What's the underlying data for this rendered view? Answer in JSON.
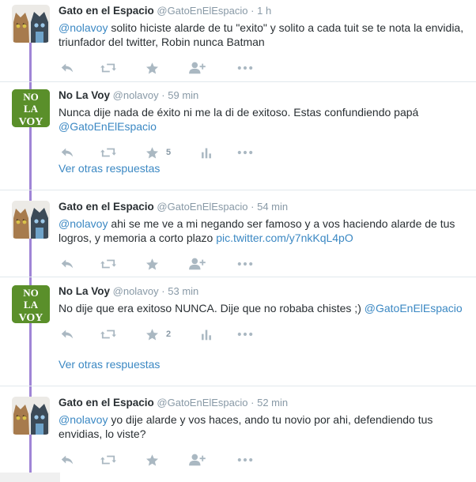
{
  "colors": {
    "thread_line": "#a085d6",
    "link": "#3b88c3",
    "meta": "#8899a6",
    "icon": "#aab8c2"
  },
  "tweets": [
    {
      "fullname": "Gato en el Espacio",
      "handle": "@GatoEnElEspacio",
      "sep": "·",
      "time": "1 h",
      "text": {
        "mention": "@nolavoy",
        "rest": " solito hiciste alarde de tu \"exito\" y solito a cada tuit se te nota la envidia, triunfador del twitter, Robin nunca Batman"
      },
      "stats": {
        "favorites": ""
      }
    },
    {
      "fullname": "No La Voy",
      "handle": "@nolavoy",
      "sep": "·",
      "time": "59 min",
      "text": {
        "before": "Nunca dije nada de éxito ni me la di de exitoso. Estas confundiendo papá ",
        "mention": "@GatoEnElEspacio"
      },
      "stats": {
        "favorites": "5"
      },
      "more_replies": "Ver otras respuestas"
    },
    {
      "fullname": "Gato en el Espacio",
      "handle": "@GatoEnElEspacio",
      "sep": "·",
      "time": "54 min",
      "text": {
        "mention": "@nolavoy",
        "rest": " ahi se me ve a mi negando ser famoso y a vos haciendo alarde de tus logros, y memoria a corto plazo ",
        "link": "pic.twitter.com/y7nkKqL4pO"
      },
      "stats": {
        "favorites": ""
      }
    },
    {
      "fullname": "No La Voy",
      "handle": "@nolavoy",
      "sep": "·",
      "time": "53 min",
      "text": {
        "before": "No dije que era exitoso NUNCA. Dije que no robaba chistes ;) ",
        "mention": "@GatoEnElEspacio"
      },
      "stats": {
        "favorites": "2"
      },
      "more_replies": "Ver otras respuestas"
    },
    {
      "fullname": "Gato en el Espacio",
      "handle": "@GatoEnElEspacio",
      "sep": "·",
      "time": "52 min",
      "text": {
        "mention": "@nolavoy",
        "rest": " yo dije alarde y vos haces, ando tu novio por ahi, defendiendo tus envidias, lo viste?"
      },
      "stats": {
        "favorites": ""
      }
    }
  ],
  "avatars": {
    "nolavoy_lines": [
      "NO",
      "LA",
      "VOY"
    ]
  }
}
